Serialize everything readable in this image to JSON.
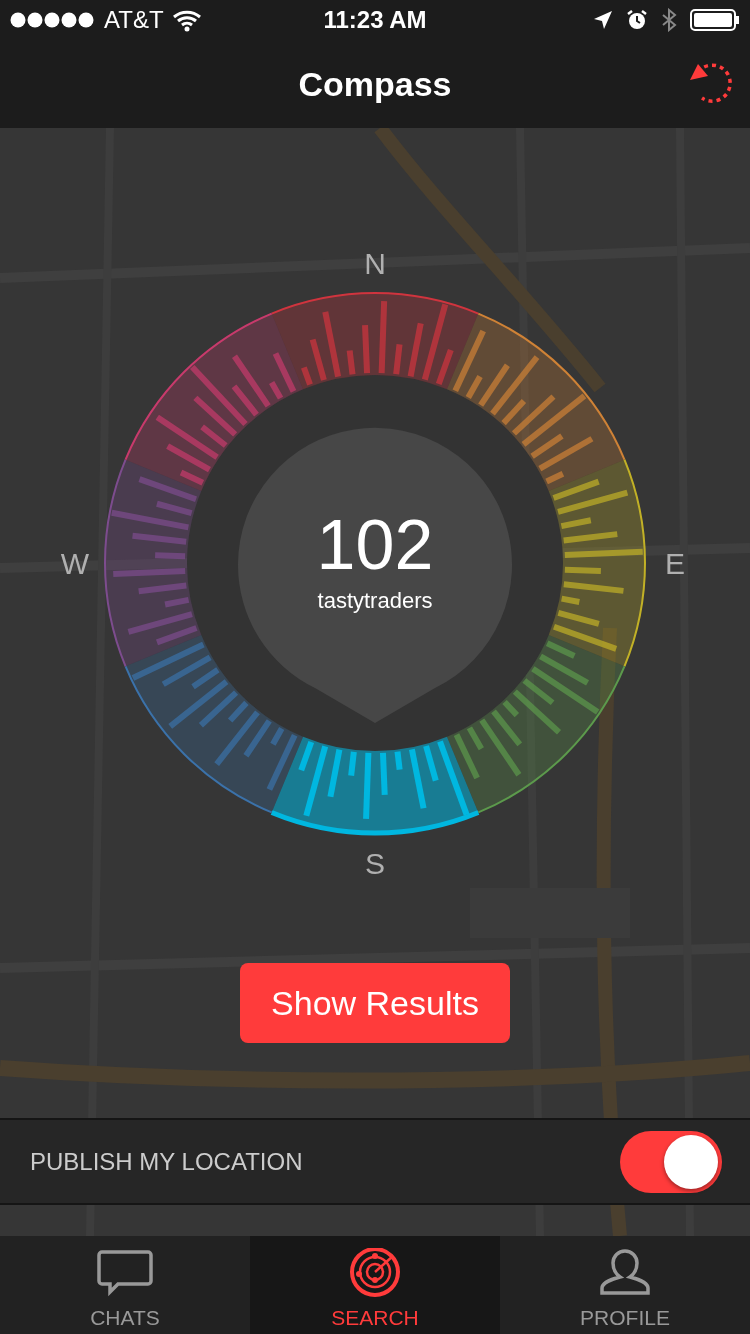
{
  "status_bar": {
    "carrier": "AT&T",
    "time": "11:23 AM"
  },
  "nav": {
    "title": "Compass"
  },
  "compass": {
    "directions": [
      {
        "label": "N"
      },
      {
        "label": "E"
      },
      {
        "label": "S"
      },
      {
        "label": "W"
      }
    ],
    "sectors": [
      {
        "color": "#d0343e",
        "selected": false
      },
      {
        "color": "#cf8236",
        "selected": false
      },
      {
        "color": "#c2b126",
        "selected": false
      },
      {
        "color": "#5c9a4c",
        "selected": false
      },
      {
        "color": "#00b7e0",
        "selected": true
      },
      {
        "color": "#3b72aa",
        "selected": false
      },
      {
        "color": "#7d4c8e",
        "selected": false
      },
      {
        "color": "#c83a6c",
        "selected": false
      }
    ],
    "count": "102",
    "label": "tastytraders"
  },
  "show_results_button": "Show Results",
  "publish_location": {
    "label": "PUBLISH MY LOCATION",
    "on": true
  },
  "tabs": [
    {
      "kind": "chats",
      "label": "CHATS",
      "selected": false
    },
    {
      "kind": "search",
      "label": "SEARCH",
      "selected": true
    },
    {
      "kind": "profile",
      "label": "PROFILE",
      "selected": false
    }
  ]
}
